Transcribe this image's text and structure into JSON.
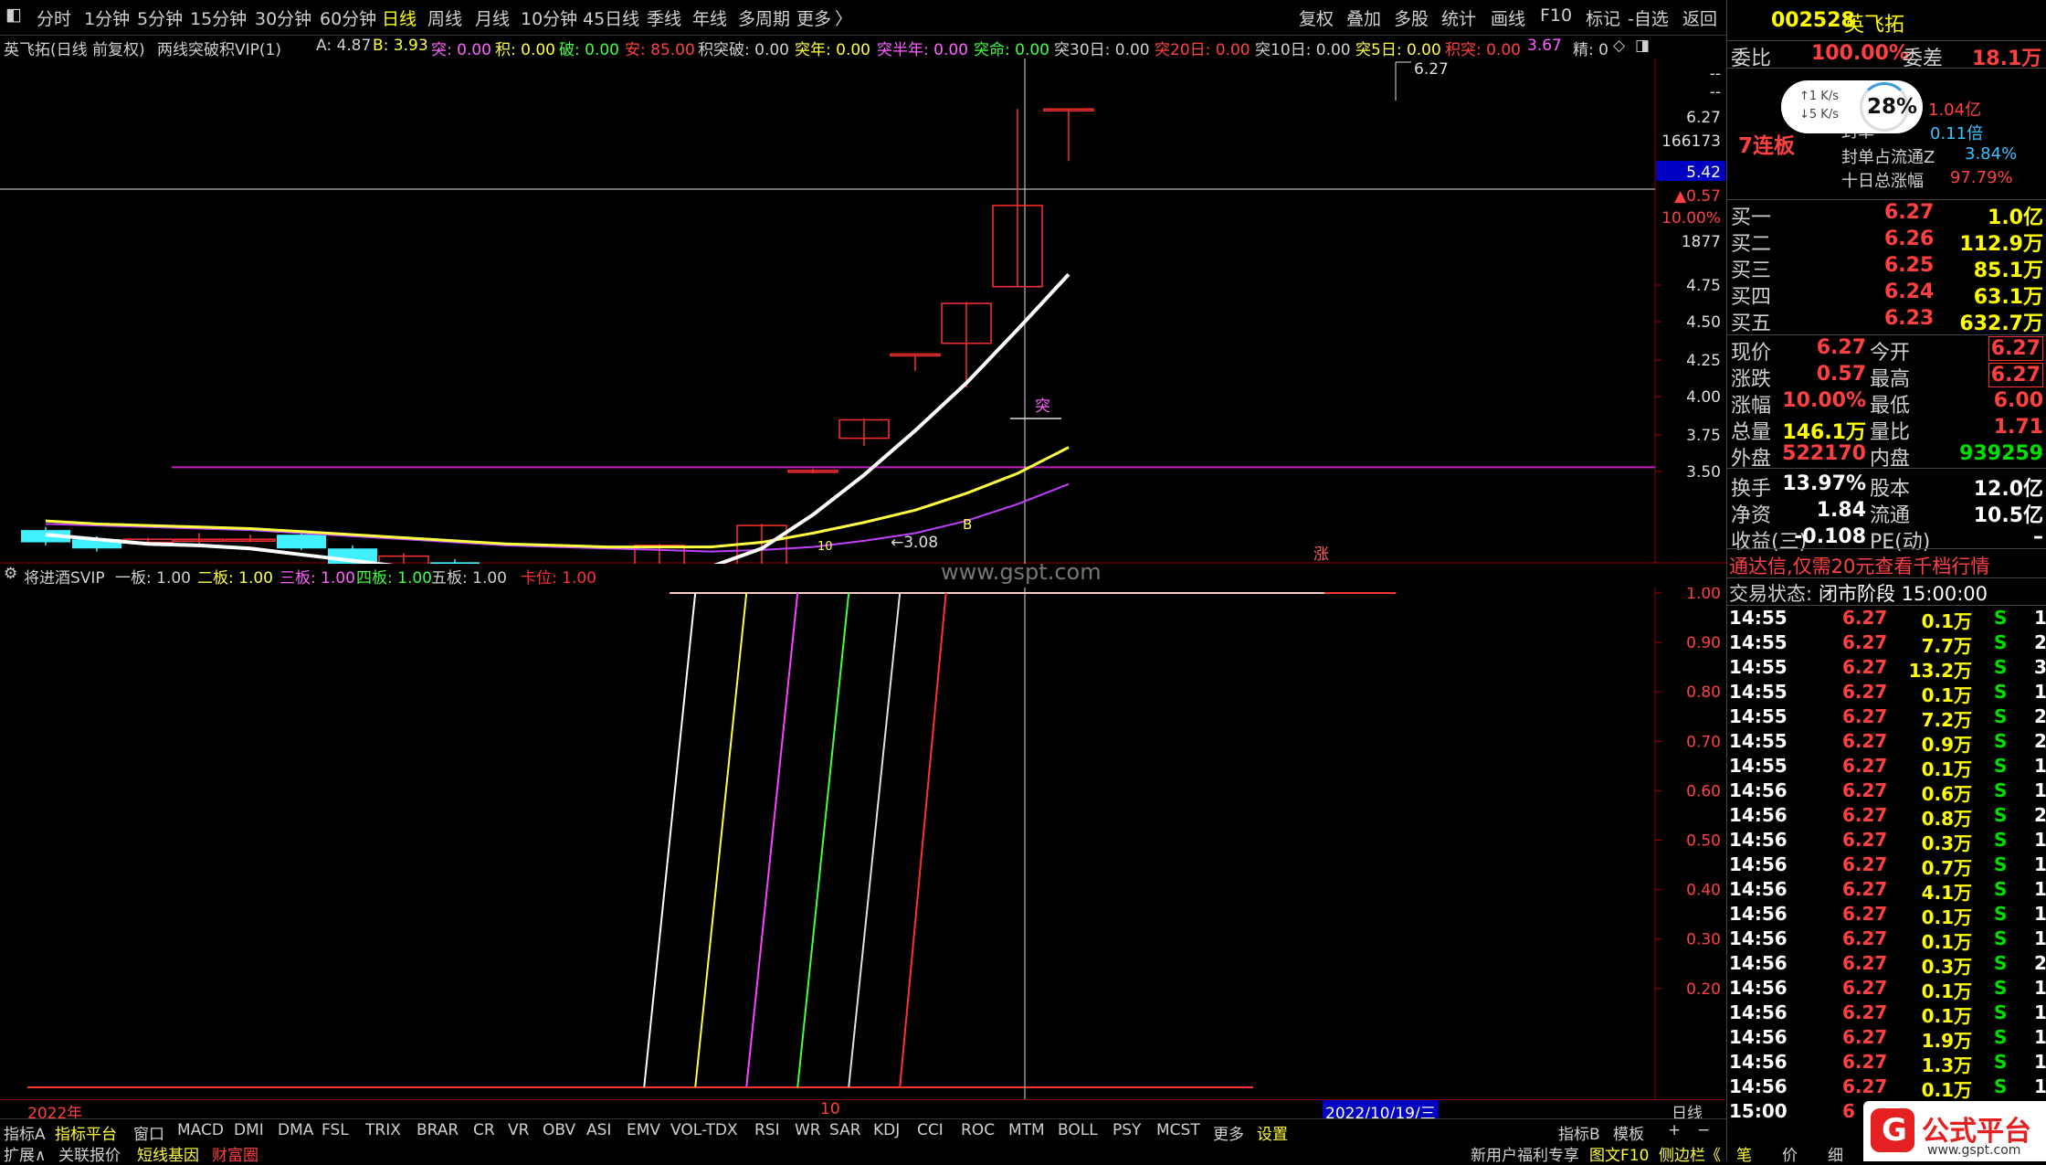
{
  "topbar": {
    "icon": "window-icon",
    "periods": [
      "分时",
      "1分钟",
      "5分钟",
      "15分钟",
      "30分钟",
      "60分钟",
      "日线",
      "周线",
      "月线",
      "10分钟",
      "45日线",
      "季线",
      "年线",
      "多周期",
      "更多"
    ],
    "active": "日线",
    "right_buttons": [
      "复权",
      "叠加",
      "多股",
      "统计",
      "画线",
      "F10",
      "标记",
      "-自选",
      "返回"
    ]
  },
  "inforow": {
    "stock_label": "英飞拓(日线 前复权)",
    "indicator": "两线突破积VIP(1)",
    "A": "A: 4.87",
    "B": "B: 3.93",
    "tu": "突: 0.00",
    "ji": "积: 0.00",
    "po": "破: 0.00",
    "an": "安: 85.00",
    "jitupo": "积突破: 0.00",
    "tunian": "突年: 0.00",
    "tubannian": "突半年: 0.00",
    "tuming": "突命: 0.00",
    "tu30": "突30日: 0.00",
    "tu20": "突20日: 0.00",
    "tu10": "突10日: 0.00",
    "tu5": "突5日: 0.00",
    "jitu": "积突: 0.00",
    "val367": "3.67",
    "jing": "精: 0"
  },
  "main_chart": {
    "price_axis": [
      {
        "label": "--"
      },
      {
        "label": "--"
      },
      {
        "label": "6.27"
      },
      {
        "label": "166173"
      },
      {
        "label": "5.42"
      },
      {
        "label": "▲0.57"
      },
      {
        "label": "10.00%"
      },
      {
        "label": "1877"
      },
      {
        "label": "4.75"
      },
      {
        "label": "4.50"
      },
      {
        "label": "4.25"
      },
      {
        "label": "4.00"
      },
      {
        "label": "3.75"
      },
      {
        "label": "3.50"
      }
    ],
    "annotations": {
      "high_label": "6.27",
      "low_label": "←3.08",
      "tu_label": "突",
      "b_label": "B",
      "zhang_label": "涨",
      "m10": "10"
    }
  },
  "chart_data": [
    {
      "type": "candlestick",
      "title": "",
      "ylim": [
        3.3,
        6.6
      ],
      "candles": [
        {
          "o": 3.44,
          "c": 3.52,
          "h": 3.54,
          "l": 3.42,
          "up": false
        },
        {
          "o": 3.46,
          "c": 3.4,
          "h": 3.48,
          "l": 3.38,
          "up": false
        },
        {
          "o": 3.44,
          "c": 3.46,
          "h": 3.47,
          "l": 3.42,
          "up": true
        },
        {
          "o": 3.45,
          "c": 3.46,
          "h": 3.5,
          "l": 3.43,
          "up": true
        },
        {
          "o": 3.46,
          "c": 3.45,
          "h": 3.49,
          "l": 3.44,
          "up": true
        },
        {
          "o": 3.49,
          "c": 3.4,
          "h": 3.51,
          "l": 3.39,
          "up": false
        },
        {
          "o": 3.4,
          "c": 3.29,
          "h": 3.42,
          "l": 3.28,
          "up": false
        },
        {
          "o": 3.35,
          "c": 3.29,
          "h": 3.37,
          "l": 3.27,
          "up": true
        },
        {
          "o": 3.31,
          "c": 3.22,
          "h": 3.33,
          "l": 3.2,
          "up": false
        },
        {
          "o": 3.25,
          "c": 3.2,
          "h": 3.26,
          "l": 3.18,
          "up": false
        },
        {
          "o": 3.2,
          "c": 3.19,
          "h": 3.21,
          "l": 3.14,
          "up": true
        },
        {
          "o": 3.19,
          "c": 3.19,
          "h": 3.21,
          "l": 3.17,
          "up": true
        },
        {
          "o": 3.18,
          "c": 3.42,
          "h": 3.43,
          "l": 3.18,
          "up": true
        },
        {
          "o": 3.18,
          "c": 3.21,
          "h": 3.22,
          "l": 3.08,
          "up": true
        },
        {
          "o": 3.22,
          "c": 3.55,
          "h": 3.56,
          "l": 3.2,
          "up": true
        },
        {
          "o": 3.9,
          "c": 3.91,
          "h": 3.92,
          "l": 3.89,
          "up": true
        },
        {
          "o": 4.12,
          "c": 4.24,
          "h": 4.25,
          "l": 4.07,
          "up": true
        },
        {
          "o": 4.66,
          "c": 4.67,
          "h": 4.67,
          "l": 4.56,
          "up": true
        },
        {
          "o": 4.74,
          "c": 5.0,
          "h": 5.01,
          "l": 4.45,
          "up": true
        },
        {
          "o": 5.11,
          "c": 5.64,
          "h": 6.27,
          "l": 5.11,
          "up": true
        },
        {
          "o": 6.27,
          "c": 6.27,
          "h": 6.27,
          "l": 5.93,
          "up": true
        }
      ],
      "ma_white": [
        3.49,
        3.46,
        3.43,
        3.42,
        3.4,
        3.36,
        3.32,
        3.28,
        3.24,
        3.21,
        3.2,
        3.2,
        3.22,
        3.28,
        3.4,
        3.62,
        3.88,
        4.17,
        4.48,
        4.83,
        5.19
      ],
      "ma_yellow": [
        3.58,
        3.56,
        3.55,
        3.54,
        3.53,
        3.51,
        3.49,
        3.47,
        3.45,
        3.43,
        3.42,
        3.41,
        3.41,
        3.41,
        3.44,
        3.5,
        3.57,
        3.65,
        3.76,
        3.89,
        4.06
      ],
      "ma_magenta": [
        3.56,
        3.55,
        3.54,
        3.53,
        3.52,
        3.5,
        3.48,
        3.46,
        3.44,
        3.42,
        3.41,
        3.4,
        3.39,
        3.38,
        3.39,
        3.41,
        3.45,
        3.5,
        3.58,
        3.69,
        3.82
      ],
      "hline_magenta": 3.93,
      "hline_yellow": 3.14
    },
    {
      "type": "line",
      "title": "将进酒SVIP",
      "ylim": [
        0,
        1.0
      ],
      "yticks": [
        1.0,
        0.9,
        0.8,
        0.7,
        0.6,
        0.5,
        0.4,
        0.3,
        0.2
      ],
      "series": [
        {
          "name": "一板",
          "value": "1.00",
          "color": "#ffffff",
          "x0": 12.2,
          "x1": 13.2
        },
        {
          "name": "二板",
          "value": "1.00",
          "color": "#ffff40",
          "x0": 13.2,
          "x1": 14.2
        },
        {
          "name": "三板",
          "value": "1.00",
          "color": "#ff40ff",
          "x0": 14.2,
          "x1": 15.2
        },
        {
          "name": "四板",
          "value": "1.00",
          "color": "#40ff40",
          "x0": 15.2,
          "x1": 16.2
        },
        {
          "name": "五板",
          "value": "1.00",
          "color": "#e0e0e0",
          "x0": 16.2,
          "x1": 17.2
        },
        {
          "name": "卡位",
          "value": "1.00",
          "color": "#ff3030",
          "x0": 17.2,
          "x1": 18.1
        }
      ]
    }
  ],
  "indicator_row": {
    "name": "将进酒SVIP",
    "items": [
      {
        "label": "一板: 1.00",
        "color": "#d0d0d0"
      },
      {
        "label": "二板: 1.00",
        "color": "#ffff40"
      },
      {
        "label": "三板: 1.00",
        "color": "#ff60ff"
      },
      {
        "label": "四板: 1.00",
        "color": "#40ff40"
      },
      {
        "label": "五板: 1.00",
        "color": "#d0d0d0"
      },
      {
        "label": "卡位: 1.00",
        "color": "#ff3030"
      }
    ]
  },
  "xaxis": {
    "year": "2022年",
    "month": "10",
    "date": "2022/10/19/三",
    "period": "日线"
  },
  "watermark": "www.gspt.com",
  "right_panel": {
    "code": "002528",
    "name": "英飞拓",
    "weibi_label": "委比",
    "weibi": "100.00%",
    "weicha_label": "委差",
    "weicha": "18.1万",
    "lianban": "7连板",
    "speed_up": "↑1 K/s",
    "speed_down": "↓5 K/s",
    "gauge": "28%",
    "fengdan": "1.04亿",
    "fengdan_label": "封单",
    "bei": "0.11倍",
    "fengdan_ratio_label": "封单占流通Z",
    "fengdan_ratio": "3.84%",
    "tenday_label": "十日总涨幅",
    "tenday": "97.79%",
    "orders": [
      {
        "label": "买一",
        "price": "6.27",
        "vol": "1.0亿"
      },
      {
        "label": "买二",
        "price": "6.26",
        "vol": "112.9万"
      },
      {
        "label": "买三",
        "price": "6.25",
        "vol": "85.1万"
      },
      {
        "label": "买四",
        "price": "6.24",
        "vol": "63.1万"
      },
      {
        "label": "买五",
        "price": "6.23",
        "vol": "632.7万"
      }
    ],
    "stats": [
      {
        "l1": "现价",
        "v1": "6.27",
        "l2": "今开",
        "v2": "6.27",
        "c1": "red",
        "c2": "red",
        "box": true
      },
      {
        "l1": "涨跌",
        "v1": "0.57",
        "l2": "最高",
        "v2": "6.27",
        "c1": "red",
        "c2": "red",
        "box": true
      },
      {
        "l1": "涨幅",
        "v1": "10.00%",
        "l2": "最低",
        "v2": "6.00",
        "c1": "red",
        "c2": "red",
        "box": false
      },
      {
        "l1": "总量",
        "v1": "146.1万",
        "l2": "量比",
        "v2": "1.71",
        "c1": "yel",
        "c2": "red",
        "box": false
      },
      {
        "l1": "外盘",
        "v1": "522170",
        "l2": "内盘",
        "v2": "939259",
        "c1": "red",
        "c2": "grn",
        "box": false
      },
      {
        "l1": "换手",
        "v1": "13.97%",
        "l2": "股本",
        "v2": "12.0亿",
        "c1": "wht",
        "c2": "wht",
        "box": false
      },
      {
        "l1": "净资",
        "v1": "1.84",
        "l2": "流通",
        "v2": "10.5亿",
        "c1": "wht",
        "c2": "wht",
        "box": false
      },
      {
        "l1": "收益(三)",
        "v1": "-0.108",
        "l2": "PE(动)",
        "v2": "–",
        "c1": "wht",
        "c2": "wht",
        "box": false
      }
    ],
    "promo": "通达信,仅需20元查看千档行情",
    "status_label": "交易状态:",
    "status": "闭市阶段 15:00:00",
    "ticks": [
      {
        "t": "14:55",
        "p": "6.27",
        "v": "0.1万",
        "s": "S",
        "n": "1"
      },
      {
        "t": "14:55",
        "p": "6.27",
        "v": "7.7万",
        "s": "S",
        "n": "2"
      },
      {
        "t": "14:55",
        "p": "6.27",
        "v": "13.2万",
        "s": "S",
        "n": "3"
      },
      {
        "t": "14:55",
        "p": "6.27",
        "v": "0.1万",
        "s": "S",
        "n": "1"
      },
      {
        "t": "14:55",
        "p": "6.27",
        "v": "7.2万",
        "s": "S",
        "n": "2"
      },
      {
        "t": "14:55",
        "p": "6.27",
        "v": "0.9万",
        "s": "S",
        "n": "2"
      },
      {
        "t": "14:55",
        "p": "6.27",
        "v": "0.1万",
        "s": "S",
        "n": "1"
      },
      {
        "t": "14:56",
        "p": "6.27",
        "v": "0.6万",
        "s": "S",
        "n": "1"
      },
      {
        "t": "14:56",
        "p": "6.27",
        "v": "0.8万",
        "s": "S",
        "n": "2"
      },
      {
        "t": "14:56",
        "p": "6.27",
        "v": "0.3万",
        "s": "S",
        "n": "1"
      },
      {
        "t": "14:56",
        "p": "6.27",
        "v": "0.7万",
        "s": "S",
        "n": "1"
      },
      {
        "t": "14:56",
        "p": "6.27",
        "v": "4.1万",
        "s": "S",
        "n": "1"
      },
      {
        "t": "14:56",
        "p": "6.27",
        "v": "0.1万",
        "s": "S",
        "n": "1"
      },
      {
        "t": "14:56",
        "p": "6.27",
        "v": "0.1万",
        "s": "S",
        "n": "1"
      },
      {
        "t": "14:56",
        "p": "6.27",
        "v": "0.3万",
        "s": "S",
        "n": "2"
      },
      {
        "t": "14:56",
        "p": "6.27",
        "v": "0.1万",
        "s": "S",
        "n": "1"
      },
      {
        "t": "14:56",
        "p": "6.27",
        "v": "0.1万",
        "s": "S",
        "n": "1"
      },
      {
        "t": "14:56",
        "p": "6.27",
        "v": "1.9万",
        "s": "S",
        "n": "1"
      },
      {
        "t": "14:56",
        "p": "6.27",
        "v": "1.3万",
        "s": "S",
        "n": "1"
      },
      {
        "t": "14:56",
        "p": "6.27",
        "v": "0.1万",
        "s": "S",
        "n": "1"
      },
      {
        "t": "15:00",
        "p": "6",
        "v": "",
        "s": "",
        "n": "6"
      }
    ],
    "bottom_tabs": [
      "笔",
      "价",
      "细"
    ]
  },
  "tabs": {
    "items": [
      "指标A",
      "指标平台",
      "窗口",
      "MACD",
      "DMI",
      "DMA",
      "FSL",
      "TRIX",
      "BRAR",
      "CR",
      "VR",
      "OBV",
      "ASI",
      "EMV",
      "VOL-TDX",
      "RSI",
      "WR",
      "SAR",
      "KDJ",
      "CCI",
      "ROC",
      "MTM",
      "BOLL",
      "PSY",
      "MCST",
      "更多",
      "设置"
    ],
    "right": [
      "指标B",
      "模板",
      "+",
      "−"
    ],
    "row2": [
      "扩展∧",
      "关联报价",
      "短线基因",
      "财富圈"
    ],
    "row2_right": [
      "新用户福利专享",
      "图文F10",
      "侧边栏《"
    ]
  },
  "logo": {
    "text": "公式平台",
    "url_text": "www.gspt.com"
  },
  "colors": {
    "up": "#ff3030",
    "down": "#40f0ff",
    "bg": "#000000",
    "ma_white": "#ffffff",
    "ma_yellow": "#ffff40",
    "ma_magenta": "#c040ff"
  }
}
